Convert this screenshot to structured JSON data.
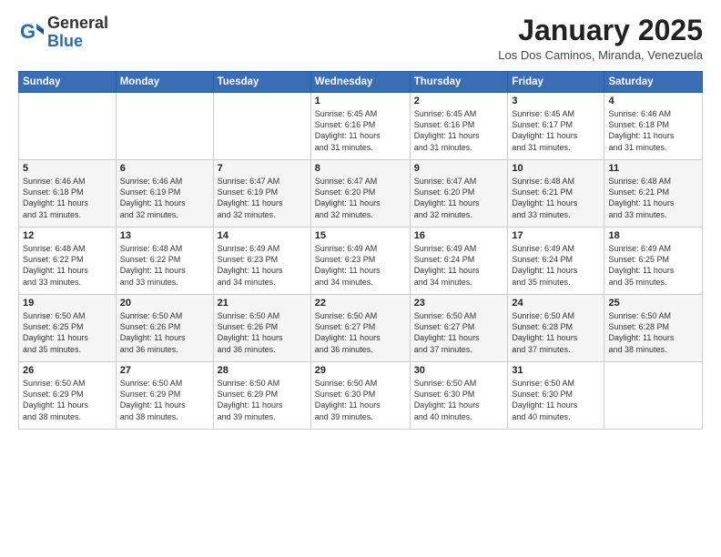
{
  "header": {
    "logo_general": "General",
    "logo_blue": "Blue",
    "month_title": "January 2025",
    "location": "Los Dos Caminos, Miranda, Venezuela"
  },
  "days_of_week": [
    "Sunday",
    "Monday",
    "Tuesday",
    "Wednesday",
    "Thursday",
    "Friday",
    "Saturday"
  ],
  "weeks": [
    [
      {
        "day": "",
        "info": ""
      },
      {
        "day": "",
        "info": ""
      },
      {
        "day": "",
        "info": ""
      },
      {
        "day": "1",
        "info": "Sunrise: 6:45 AM\nSunset: 6:16 PM\nDaylight: 11 hours\nand 31 minutes."
      },
      {
        "day": "2",
        "info": "Sunrise: 6:45 AM\nSunset: 6:16 PM\nDaylight: 11 hours\nand 31 minutes."
      },
      {
        "day": "3",
        "info": "Sunrise: 6:45 AM\nSunset: 6:17 PM\nDaylight: 11 hours\nand 31 minutes."
      },
      {
        "day": "4",
        "info": "Sunrise: 6:46 AM\nSunset: 6:18 PM\nDaylight: 11 hours\nand 31 minutes."
      }
    ],
    [
      {
        "day": "5",
        "info": "Sunrise: 6:46 AM\nSunset: 6:18 PM\nDaylight: 11 hours\nand 31 minutes."
      },
      {
        "day": "6",
        "info": "Sunrise: 6:46 AM\nSunset: 6:19 PM\nDaylight: 11 hours\nand 32 minutes."
      },
      {
        "day": "7",
        "info": "Sunrise: 6:47 AM\nSunset: 6:19 PM\nDaylight: 11 hours\nand 32 minutes."
      },
      {
        "day": "8",
        "info": "Sunrise: 6:47 AM\nSunset: 6:20 PM\nDaylight: 11 hours\nand 32 minutes."
      },
      {
        "day": "9",
        "info": "Sunrise: 6:47 AM\nSunset: 6:20 PM\nDaylight: 11 hours\nand 32 minutes."
      },
      {
        "day": "10",
        "info": "Sunrise: 6:48 AM\nSunset: 6:21 PM\nDaylight: 11 hours\nand 33 minutes."
      },
      {
        "day": "11",
        "info": "Sunrise: 6:48 AM\nSunset: 6:21 PM\nDaylight: 11 hours\nand 33 minutes."
      }
    ],
    [
      {
        "day": "12",
        "info": "Sunrise: 6:48 AM\nSunset: 6:22 PM\nDaylight: 11 hours\nand 33 minutes."
      },
      {
        "day": "13",
        "info": "Sunrise: 6:48 AM\nSunset: 6:22 PM\nDaylight: 11 hours\nand 33 minutes."
      },
      {
        "day": "14",
        "info": "Sunrise: 6:49 AM\nSunset: 6:23 PM\nDaylight: 11 hours\nand 34 minutes."
      },
      {
        "day": "15",
        "info": "Sunrise: 6:49 AM\nSunset: 6:23 PM\nDaylight: 11 hours\nand 34 minutes."
      },
      {
        "day": "16",
        "info": "Sunrise: 6:49 AM\nSunset: 6:24 PM\nDaylight: 11 hours\nand 34 minutes."
      },
      {
        "day": "17",
        "info": "Sunrise: 6:49 AM\nSunset: 6:24 PM\nDaylight: 11 hours\nand 35 minutes."
      },
      {
        "day": "18",
        "info": "Sunrise: 6:49 AM\nSunset: 6:25 PM\nDaylight: 11 hours\nand 35 minutes."
      }
    ],
    [
      {
        "day": "19",
        "info": "Sunrise: 6:50 AM\nSunset: 6:25 PM\nDaylight: 11 hours\nand 35 minutes."
      },
      {
        "day": "20",
        "info": "Sunrise: 6:50 AM\nSunset: 6:26 PM\nDaylight: 11 hours\nand 36 minutes."
      },
      {
        "day": "21",
        "info": "Sunrise: 6:50 AM\nSunset: 6:26 PM\nDaylight: 11 hours\nand 36 minutes."
      },
      {
        "day": "22",
        "info": "Sunrise: 6:50 AM\nSunset: 6:27 PM\nDaylight: 11 hours\nand 36 minutes."
      },
      {
        "day": "23",
        "info": "Sunrise: 6:50 AM\nSunset: 6:27 PM\nDaylight: 11 hours\nand 37 minutes."
      },
      {
        "day": "24",
        "info": "Sunrise: 6:50 AM\nSunset: 6:28 PM\nDaylight: 11 hours\nand 37 minutes."
      },
      {
        "day": "25",
        "info": "Sunrise: 6:50 AM\nSunset: 6:28 PM\nDaylight: 11 hours\nand 38 minutes."
      }
    ],
    [
      {
        "day": "26",
        "info": "Sunrise: 6:50 AM\nSunset: 6:29 PM\nDaylight: 11 hours\nand 38 minutes."
      },
      {
        "day": "27",
        "info": "Sunrise: 6:50 AM\nSunset: 6:29 PM\nDaylight: 11 hours\nand 38 minutes."
      },
      {
        "day": "28",
        "info": "Sunrise: 6:50 AM\nSunset: 6:29 PM\nDaylight: 11 hours\nand 39 minutes."
      },
      {
        "day": "29",
        "info": "Sunrise: 6:50 AM\nSunset: 6:30 PM\nDaylight: 11 hours\nand 39 minutes."
      },
      {
        "day": "30",
        "info": "Sunrise: 6:50 AM\nSunset: 6:30 PM\nDaylight: 11 hours\nand 40 minutes."
      },
      {
        "day": "31",
        "info": "Sunrise: 6:50 AM\nSunset: 6:30 PM\nDaylight: 11 hours\nand 40 minutes."
      },
      {
        "day": "",
        "info": ""
      }
    ]
  ]
}
